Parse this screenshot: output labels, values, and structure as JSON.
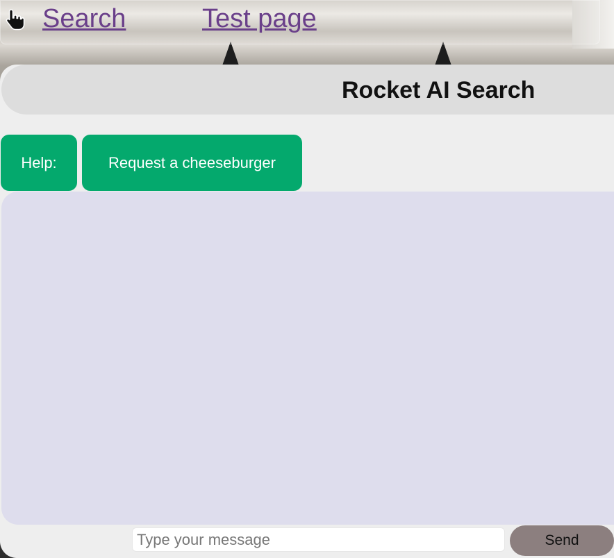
{
  "nav": {
    "links": [
      {
        "label": "Search"
      },
      {
        "label": "Test page"
      }
    ]
  },
  "header": {
    "title": "Rocket AI Search"
  },
  "help": {
    "label": "Help:",
    "suggestions": [
      {
        "label": "Request a cheeseburger"
      }
    ]
  },
  "composer": {
    "value": "",
    "placeholder": "Type your message",
    "send_label": "Send"
  },
  "colors": {
    "accent_green": "#04a96d",
    "chat_bg": "#dedded",
    "send_bg": "#8c7f7f",
    "link": "#6a3f8a"
  },
  "icons": {
    "cursor": "hand-pointer-icon"
  }
}
